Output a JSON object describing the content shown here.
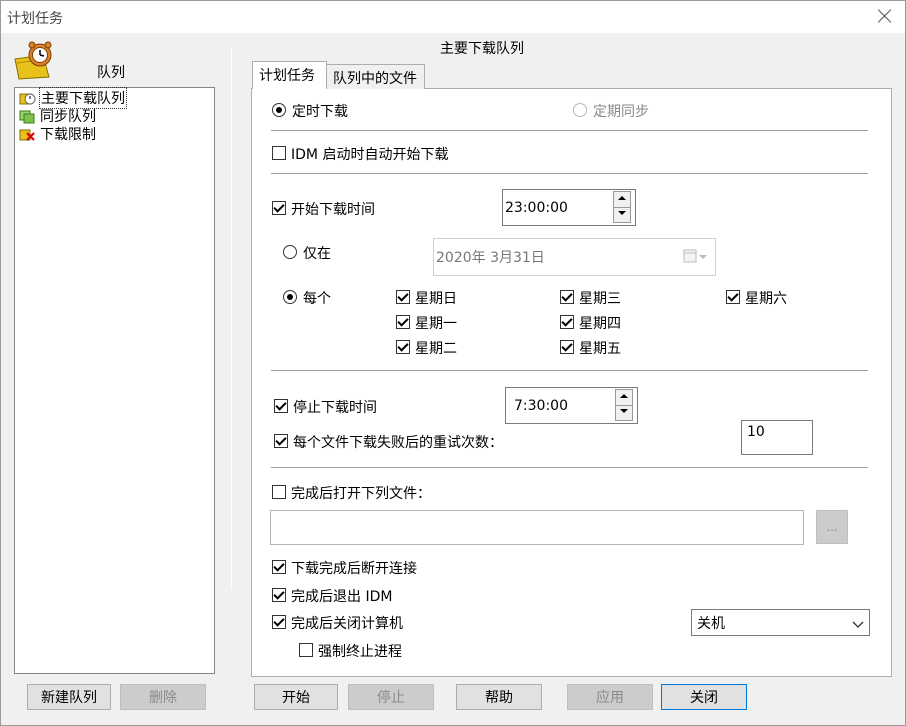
{
  "window": {
    "title": "计划任务"
  },
  "sidebar": {
    "header": "队列",
    "items": [
      {
        "label": "主要下载队列"
      },
      {
        "label": "同步队列"
      },
      {
        "label": "下载限制"
      }
    ],
    "new_button": "新建队列",
    "delete_button": "删除"
  },
  "main": {
    "heading": "主要下载队列",
    "tabs": [
      {
        "label": "计划任务"
      },
      {
        "label": "队列中的文件"
      }
    ],
    "mode_timed": "定时下载",
    "mode_sync": "定期同步",
    "start_on_idm": "IDM 启动时自动开始下载",
    "start_time_label": "开始下载时间",
    "start_time_value": "23:00:00",
    "only_on_label": "仅在",
    "date_value": "2020年  3月31日",
    "every_label": "每个",
    "days": {
      "sun": "星期日",
      "mon": "星期一",
      "tue": "星期二",
      "wed": "星期三",
      "thu": "星期四",
      "fri": "星期五",
      "sat": "星期六"
    },
    "stop_time_label": "停止下载时间",
    "stop_time_value": "7:30:00",
    "retry_label": "每个文件下载失败后的重试次数：",
    "retry_value": "10",
    "open_file_label": "完成后打开下列文件：",
    "open_file_value": "",
    "browse_label": "...",
    "hangup_label": "下载完成后断开连接",
    "exit_idm_label": "完成后退出 IDM",
    "shutdown_label": "完成后关闭计算机",
    "shutdown_option": "关机",
    "force_kill_label": "强制终止进程"
  },
  "buttons": {
    "start": "开始",
    "stop": "停止",
    "help": "帮助",
    "apply": "应用",
    "close": "关闭"
  },
  "colors": {
    "selection_border": "#0078d7",
    "disabled_text": "#8a8a8a"
  }
}
